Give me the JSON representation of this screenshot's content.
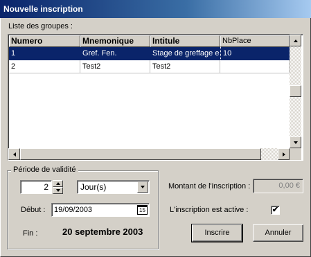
{
  "window": {
    "title": "Nouvelle inscription"
  },
  "groups": {
    "label": "Liste des groupes :",
    "columns": [
      "Numero",
      "Mnemonique",
      "Intitule",
      "NbPlace"
    ],
    "rows": [
      {
        "numero": "1",
        "mnemonique": "Gref. Fen.",
        "intitule": "Stage de greffage e",
        "nbplace": "10",
        "selected": true
      },
      {
        "numero": "2",
        "mnemonique": "Test2",
        "intitule": "Test2",
        "nbplace": "",
        "selected": false
      }
    ]
  },
  "validity": {
    "label": "Période de validité",
    "duration_value": "2",
    "duration_unit": "Jour(s)",
    "start_label": "Début :",
    "start_date": "19/09/2003",
    "calendar_day": "15",
    "end_label": "Fin :",
    "end_date": "20 septembre 2003"
  },
  "amount": {
    "label": "Montant de l'inscription :",
    "value": "0,00 €"
  },
  "active": {
    "label": "L'inscription est active :",
    "checked": true,
    "mark": "✔"
  },
  "buttons": {
    "submit": "Inscrire",
    "cancel": "Annuler"
  },
  "icons": {
    "spin_up": "spin-up-icon",
    "spin_down": "spin-down-icon",
    "combo": "chevron-down-icon",
    "calendar": "calendar-icon"
  },
  "colors": {
    "title_bar": "#0a246a",
    "selection": "#0a246a",
    "background": "#d4d0c8"
  }
}
